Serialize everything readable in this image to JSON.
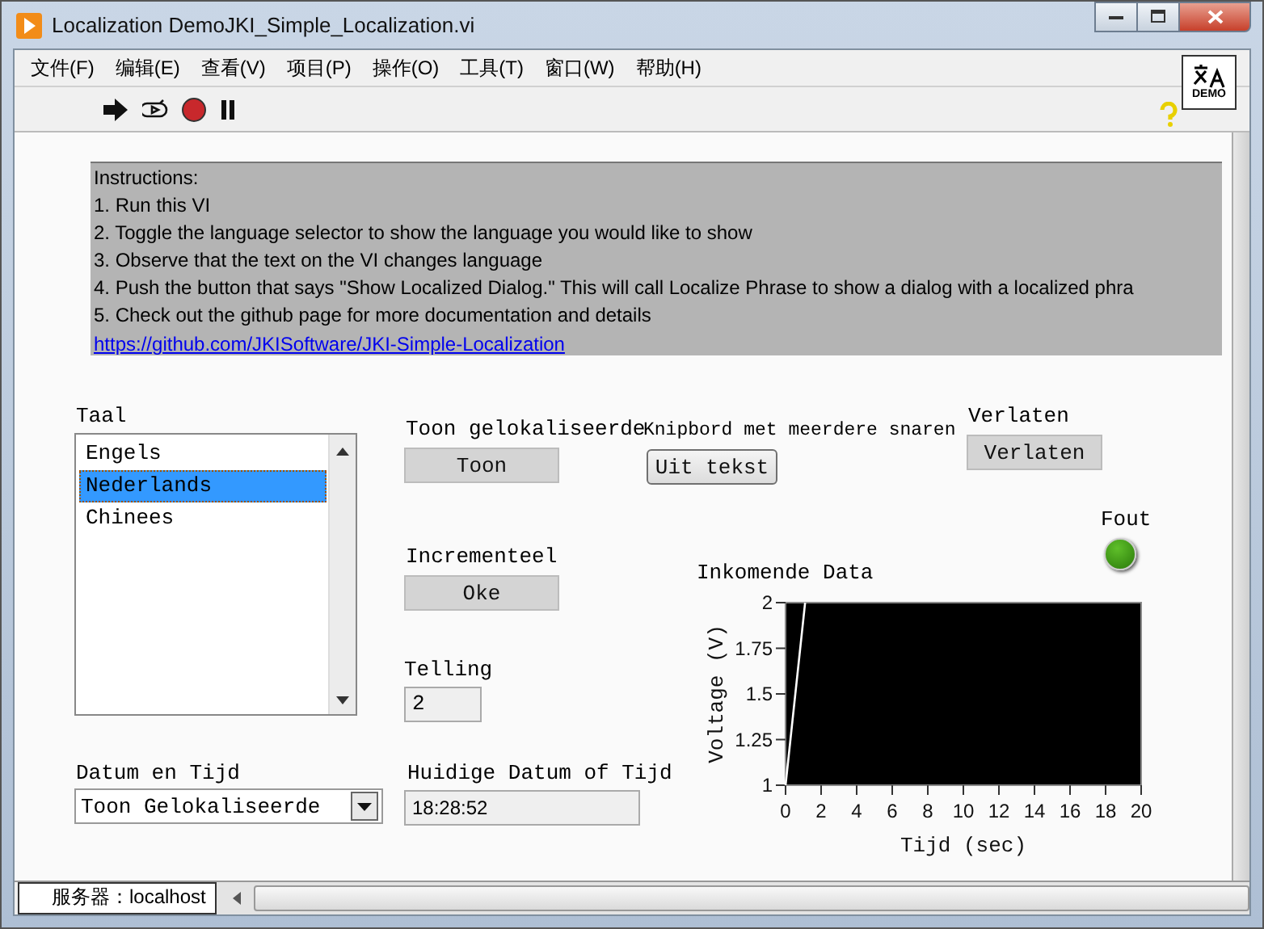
{
  "window": {
    "title": "Localization DemoJKI_Simple_Localization.vi"
  },
  "menu": [
    "文件(F)",
    "编辑(E)",
    "查看(V)",
    "项目(P)",
    "操作(O)",
    "工具(T)",
    "窗口(W)",
    "帮助(H)"
  ],
  "demo_badge": "DEMO",
  "instructions": {
    "lines": [
      "Instructions:",
      "1. Run this VI",
      "2. Toggle the language selector to show the language you would like to show",
      "3. Observe that the text on the VI changes language",
      "4. Push the button that says \"Show Localized Dialog.\" This will call Localize Phrase to show a dialog with a localized phra",
      "5. Check out the github page for more documentation and details"
    ],
    "link": "https://github.com/JKISoftware/JKI-Simple-Localization"
  },
  "taal": {
    "label": "Taal",
    "items": [
      {
        "text": "Engels",
        "selected": false
      },
      {
        "text": "Nederlands",
        "selected": true
      },
      {
        "text": "Chinees",
        "selected": false
      }
    ]
  },
  "show_dialog": {
    "label": "Toon gelokaliseerde",
    "button": "Toon"
  },
  "clipboard": {
    "label": "Knipbord met meerdere snaren",
    "button": "Uit tekst"
  },
  "quit": {
    "label": "Verlaten",
    "button": "Verlaten"
  },
  "error": {
    "label": "Fout",
    "on": true
  },
  "incremental": {
    "label": "Incrementeel",
    "button": "Oke"
  },
  "count": {
    "label": "Telling",
    "value": "2"
  },
  "graph": {
    "label": "Inkomende Data",
    "chart_data": {
      "type": "line",
      "xlabel": "Tijd (sec)",
      "ylabel": "Voltage (V)",
      "x": [
        0,
        1.1
      ],
      "series": [
        {
          "color": "#ffffff",
          "values": [
            1,
            2
          ]
        }
      ],
      "xlim": [
        0,
        20
      ],
      "ylim": [
        1,
        2
      ],
      "xticks": [
        0,
        2,
        4,
        6,
        8,
        10,
        12,
        14,
        16,
        18,
        20
      ],
      "yticks": [
        1,
        1.25,
        1.5,
        1.75,
        2
      ]
    }
  },
  "datetime_format": {
    "label": "Datum en Tijd",
    "value": "Toon Gelokaliseerde"
  },
  "current_datetime": {
    "label": "Huidige Datum of Tijd",
    "value": "18:28:52"
  },
  "status_bar": {
    "text": "服务器：localhost"
  }
}
